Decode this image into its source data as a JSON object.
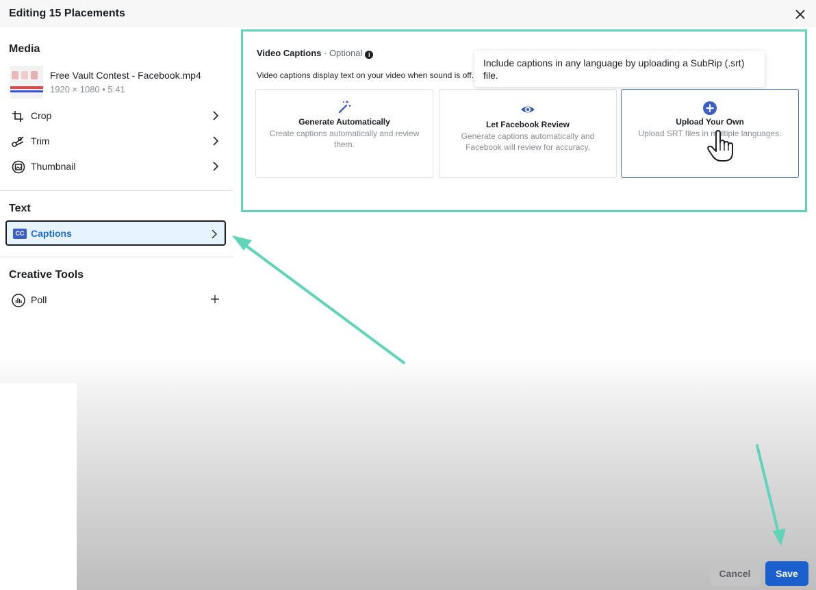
{
  "dialog": {
    "title": "Editing 15 Placements"
  },
  "sidebar": {
    "media": {
      "heading": "Media",
      "file_name": "Free Vault Contest - Facebook.mp4",
      "file_meta": "1920 × 1080 • 5:41",
      "items": [
        {
          "label": "Crop",
          "icon": "crop-icon"
        },
        {
          "label": "Trim",
          "icon": "scissors-icon"
        },
        {
          "label": "Thumbnail",
          "icon": "thumbnail-icon"
        }
      ]
    },
    "text": {
      "heading": "Text",
      "captions_badge": "CC",
      "captions_label": "Captions"
    },
    "creative_tools": {
      "heading": "Creative Tools",
      "poll_label": "Poll"
    }
  },
  "captions_panel": {
    "title": "Video Captions",
    "optional": " · Optional",
    "info_glyph": "i",
    "description": "Video captions display text on your video when sound is off.",
    "tooltip": "Include captions in any language by uploading a SubRip (.srt) file.",
    "options": [
      {
        "title": "Generate Automatically",
        "description": "Create captions automatically and review them.",
        "icon": "magic-wand-icon"
      },
      {
        "title": "Let Facebook Review",
        "description": "Generate captions automatically and Facebook will review for accuracy.",
        "icon": "eye-icon"
      },
      {
        "title": "Upload Your Own",
        "description": "Upload SRT files in multiple languages.",
        "icon": "plus-circle-icon",
        "selected": true
      }
    ]
  },
  "footer": {
    "cancel_label": "Cancel",
    "save_label": "Save"
  },
  "colors": {
    "accent": "#1b5fce",
    "highlight": "#5fd4b8",
    "captions_text": "#1b6fd0"
  }
}
